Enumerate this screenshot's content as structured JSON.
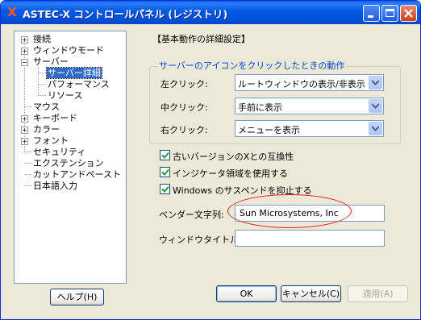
{
  "window": {
    "title": "ASTEC-X コントロールパネル (レジストリ)",
    "app_icon_glyph": "X"
  },
  "tree": {
    "items": [
      {
        "label": "接続",
        "expander": "+"
      },
      {
        "label": "ウィンドウモード",
        "expander": "+"
      },
      {
        "label": "サーバー",
        "expander": "−"
      },
      {
        "label": "サーバー詳細"
      },
      {
        "label": "パフォーマンス"
      },
      {
        "label": "リソース"
      },
      {
        "label": "マウス"
      },
      {
        "label": "キーボード",
        "expander": "+"
      },
      {
        "label": "カラー",
        "expander": "+"
      },
      {
        "label": "フォント",
        "expander": "+"
      },
      {
        "label": "セキュリティ"
      },
      {
        "label": "エクステンション"
      },
      {
        "label": "カットアンドペースト"
      },
      {
        "label": "日本語入力"
      }
    ]
  },
  "panel": {
    "heading": "【基本動作の詳細設定】",
    "group_title": "サーバーのアイコンをクリックしたときの動作",
    "left_click": {
      "label": "左クリック:",
      "value": "ルートウィンドウの表示/非表示"
    },
    "middle_click": {
      "label": "中クリック:",
      "value": "手前に表示"
    },
    "right_click": {
      "label": "右クリック:",
      "value": "メニューを表示"
    },
    "checkboxes": [
      {
        "label": "古いバージョンのXとの互換性",
        "checked": true
      },
      {
        "label": "インジケータ領域を使用する",
        "checked": true
      },
      {
        "label": "Windows のサスペンドを抑止する",
        "checked": true
      }
    ],
    "vendor": {
      "label": "ベンダー文字列:",
      "value": "Sun Microsystems, Inc"
    },
    "window_title": {
      "label": "ウィンドウタイトル:",
      "value": ""
    }
  },
  "buttons": {
    "help": "ヘルプ(H)",
    "ok": "OK",
    "cancel": "キャンセル(C)",
    "apply": "適用(A)"
  },
  "colors": {
    "titlebar": "#0058e6",
    "selection": "#316ac5",
    "group_title": "#0046d5",
    "highlight_ellipse": "#e02020"
  }
}
